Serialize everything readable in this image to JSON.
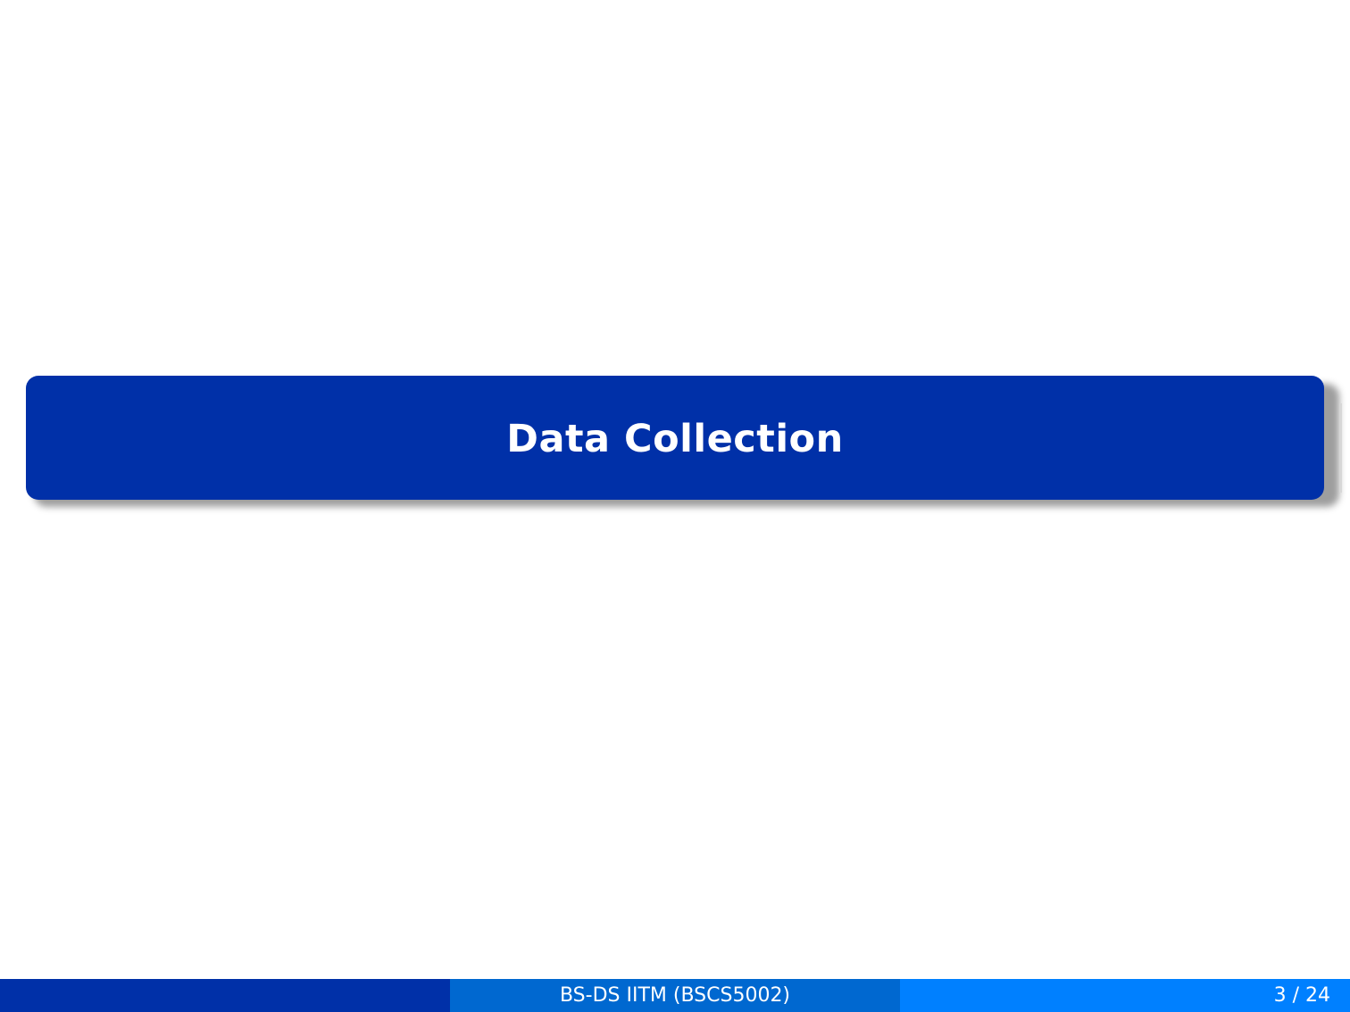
{
  "slide": {
    "title": "Data Collection"
  },
  "footer": {
    "left_text": "",
    "center_text": "BS-DS IITM (BSCS5002)",
    "page_number": "3 / 24"
  },
  "colors": {
    "title_box": "#0030a8",
    "footer_left": "#0030a8",
    "footer_middle": "#0068d0",
    "footer_right": "#0080ff",
    "text_on_dark": "#ffffff",
    "background": "#ffffff"
  }
}
